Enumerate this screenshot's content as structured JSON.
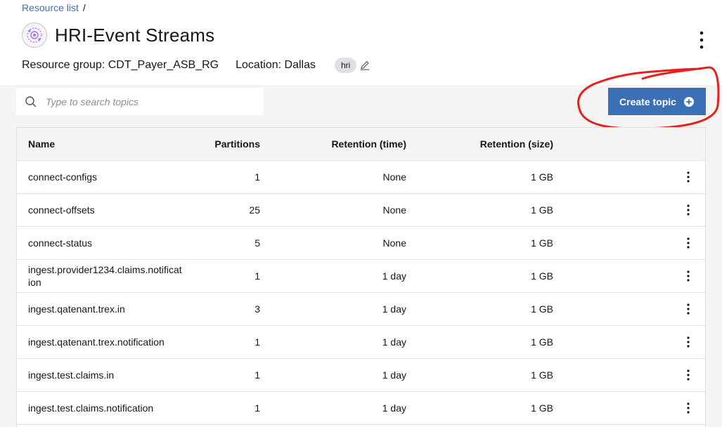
{
  "breadcrumb": {
    "link": "Resource list",
    "separator": "/"
  },
  "service": {
    "title": "HRI-Event Streams",
    "resource_group": "Resource group: CDT_Payer_ASB_RG",
    "location": "Location: Dallas",
    "tag": "hri"
  },
  "search": {
    "placeholder": "Type to search topics",
    "value": ""
  },
  "create_button": {
    "label": "Create topic",
    "color": "#3b6fb6"
  },
  "annotation_color": "#e8201b",
  "table": {
    "headers": {
      "name": "Name",
      "partitions": "Partitions",
      "retention_time": "Retention (time)",
      "retention_size": "Retention (size)"
    },
    "rows": [
      {
        "name": "connect-configs",
        "partitions": "1",
        "retention_time": "None",
        "retention_size": "1 GB"
      },
      {
        "name": "connect-offsets",
        "partitions": "25",
        "retention_time": "None",
        "retention_size": "1 GB"
      },
      {
        "name": "connect-status",
        "partitions": "5",
        "retention_time": "None",
        "retention_size": "1 GB"
      },
      {
        "name": "ingest.provider1234.claims.notification",
        "partitions": "1",
        "retention_time": "1 day",
        "retention_size": "1 GB"
      },
      {
        "name": "ingest.qatenant.trex.in",
        "partitions": "3",
        "retention_time": "1 day",
        "retention_size": "1 GB"
      },
      {
        "name": "ingest.qatenant.trex.notification",
        "partitions": "1",
        "retention_time": "1 day",
        "retention_size": "1 GB"
      },
      {
        "name": "ingest.test.claims.in",
        "partitions": "1",
        "retention_time": "1 day",
        "retention_size": "1 GB"
      },
      {
        "name": "ingest.test.claims.notification",
        "partitions": "1",
        "retention_time": "1 day",
        "retention_size": "1 GB"
      }
    ]
  }
}
